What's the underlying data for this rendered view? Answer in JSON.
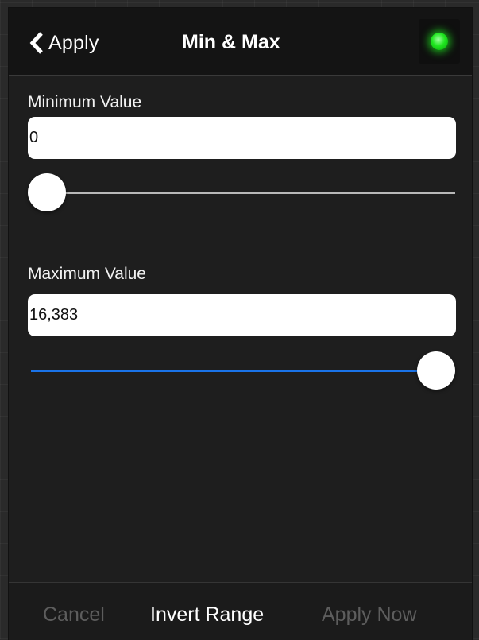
{
  "header": {
    "back_label": "Apply",
    "title": "Min & Max",
    "status_color": "#1fe61f"
  },
  "minimum": {
    "label": "Minimum Value",
    "value": "0",
    "slider_fraction": 0.0
  },
  "maximum": {
    "label": "Maximum Value",
    "value": "16,383",
    "slider_fraction": 1.0
  },
  "toolbar": {
    "cancel_label": "Cancel",
    "invert_label": "Invert Range",
    "apply_now_label": "Apply Now"
  },
  "colors": {
    "accent": "#1a73e8",
    "disabled_text": "#5d5d5d"
  },
  "icons": {
    "back": "chevron-left-icon",
    "status": "status-led-icon"
  }
}
